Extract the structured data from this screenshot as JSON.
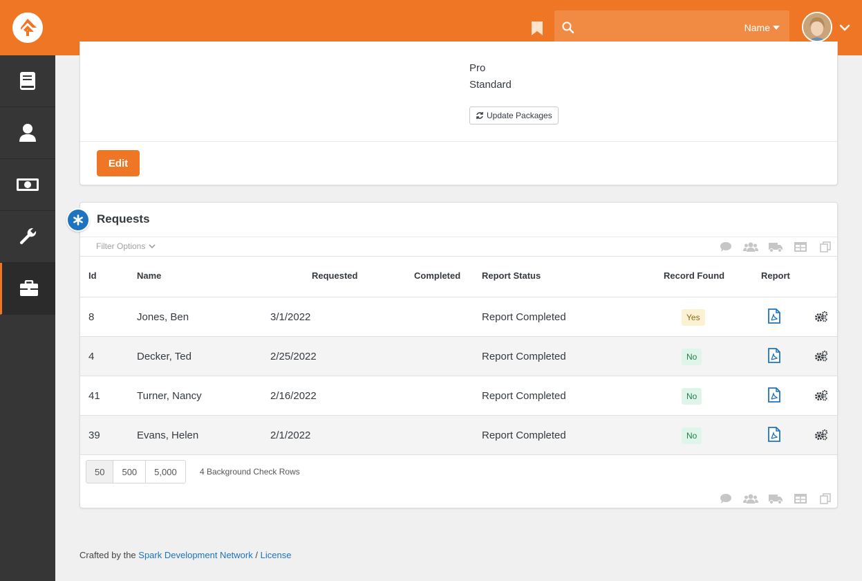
{
  "header": {
    "search_placeholder": "",
    "search_type": "Name"
  },
  "sidebar": {
    "items": [
      {
        "icon": "book-icon"
      },
      {
        "icon": "person-icon"
      },
      {
        "icon": "money-icon"
      },
      {
        "icon": "wrench-icon"
      },
      {
        "icon": "briefcase-icon",
        "active": true
      }
    ]
  },
  "details": {
    "packages": [
      "Pro",
      "Standard"
    ],
    "update_packages_label": "Update Packages",
    "edit_label": "Edit"
  },
  "requests": {
    "title": "Requests",
    "filter_label": "Filter Options",
    "columns": {
      "id": "Id",
      "name": "Name",
      "requested": "Requested",
      "completed": "Completed",
      "report_status": "Report Status",
      "record_found": "Record Found",
      "report": "Report"
    },
    "rows": [
      {
        "id": "8",
        "name": "Jones, Ben",
        "requested": "3/1/2022",
        "completed": "",
        "report_status": "Report Completed",
        "record_found": "Yes"
      },
      {
        "id": "4",
        "name": "Decker, Ted",
        "requested": "2/25/2022",
        "completed": "",
        "report_status": "Report Completed",
        "record_found": "No"
      },
      {
        "id": "41",
        "name": "Turner, Nancy",
        "requested": "2/16/2022",
        "completed": "",
        "report_status": "Report Completed",
        "record_found": "No"
      },
      {
        "id": "39",
        "name": "Evans, Helen",
        "requested": "2/1/2022",
        "completed": "",
        "report_status": "Report Completed",
        "record_found": "No"
      }
    ],
    "page_sizes": [
      "50",
      "500",
      "5,000"
    ],
    "row_count": "4 Background Check Rows"
  },
  "footer": {
    "prefix": "Crafted by the",
    "link": "Spark Development Network",
    "sep": "/",
    "license": "License"
  },
  "colors": {
    "brand": "#ee7624",
    "sidebar": "#363636",
    "link": "#1e73be"
  }
}
